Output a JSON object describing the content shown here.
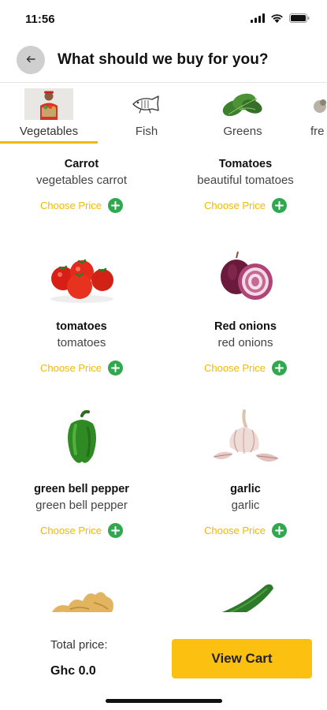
{
  "status_bar": {
    "time": "11:56"
  },
  "header": {
    "title": "What should we buy for you?"
  },
  "tabs": [
    {
      "label": "Vegetables",
      "icon": "vendor-photo-icon",
      "selected": true
    },
    {
      "label": "Fish",
      "icon": "fish-outline-icon",
      "selected": false
    },
    {
      "label": "Greens",
      "icon": "leafy-greens-icon",
      "selected": false
    },
    {
      "label": "fre",
      "icon": "fruit-icon",
      "selected": false
    }
  ],
  "products": [
    {
      "name": "Carrot",
      "description": "vegetables carrot",
      "price_label": "Choose Price",
      "icon": "carrot-icon"
    },
    {
      "name": "Tomatoes",
      "description": "beautiful tomatoes",
      "price_label": "Choose Price",
      "icon": "tomatoes-icon"
    },
    {
      "name": "tomatoes",
      "description": "tomatoes",
      "price_label": "Choose Price",
      "icon": "tomatoes-icon"
    },
    {
      "name": "Red onions",
      "description": "red onions",
      "price_label": "Choose Price",
      "icon": "red-onion-icon"
    },
    {
      "name": "green bell pepper",
      "description": "green bell pepper",
      "price_label": "Choose Price",
      "icon": "bell-pepper-icon"
    },
    {
      "name": "garlic",
      "description": "garlic",
      "price_label": "Choose Price",
      "icon": "garlic-icon"
    },
    {
      "name": "",
      "description": "",
      "price_label": "",
      "icon": "ginger-icon"
    },
    {
      "name": "",
      "description": "",
      "price_label": "",
      "icon": "cucumber-icon"
    }
  ],
  "footer": {
    "total_label": "Total price:",
    "total_value": "Ghc 0.0",
    "view_cart_label": "View Cart"
  },
  "colors": {
    "accent": "#fcc010",
    "price_text": "#f5b800",
    "add_button": "#2fa84f",
    "back_button": "#cfcfcf"
  }
}
